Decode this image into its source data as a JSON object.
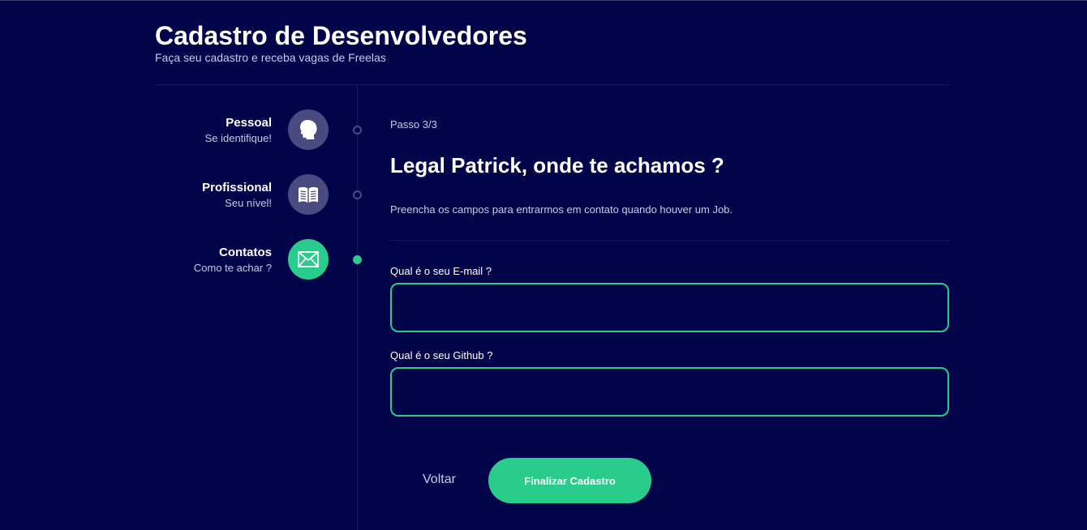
{
  "header": {
    "title": "Cadastro de Desenvolvedores",
    "subtitle": "Faça seu cadastro e receba vagas de Freelas"
  },
  "steps": [
    {
      "label": "Pessoal",
      "description": "Se identifique!",
      "icon": "user-head-icon",
      "active": false
    },
    {
      "label": "Profissional",
      "description": "Seu nível!",
      "icon": "book-icon",
      "active": false
    },
    {
      "label": "Contatos",
      "description": "Como te achar ?",
      "icon": "mail-icon",
      "active": true
    }
  ],
  "form": {
    "step_indicator": "Passo 3/3",
    "title": "Legal Patrick, onde te achamos ?",
    "description": "Preencha os campos para entrarmos em contato quando houver um Job.",
    "email": {
      "label": "Qual é o seu E-mail ?",
      "value": "",
      "placeholder": ""
    },
    "github": {
      "label": "Qual é o seu Github ?",
      "value": "",
      "placeholder": ""
    }
  },
  "actions": {
    "back_label": "Voltar",
    "finish_label": "Finalizar Cadastro"
  },
  "colors": {
    "background": "#02044a",
    "accent": "#29cc8b",
    "inactive_step": "#494a7f",
    "muted_text": "#c7c9e4"
  }
}
